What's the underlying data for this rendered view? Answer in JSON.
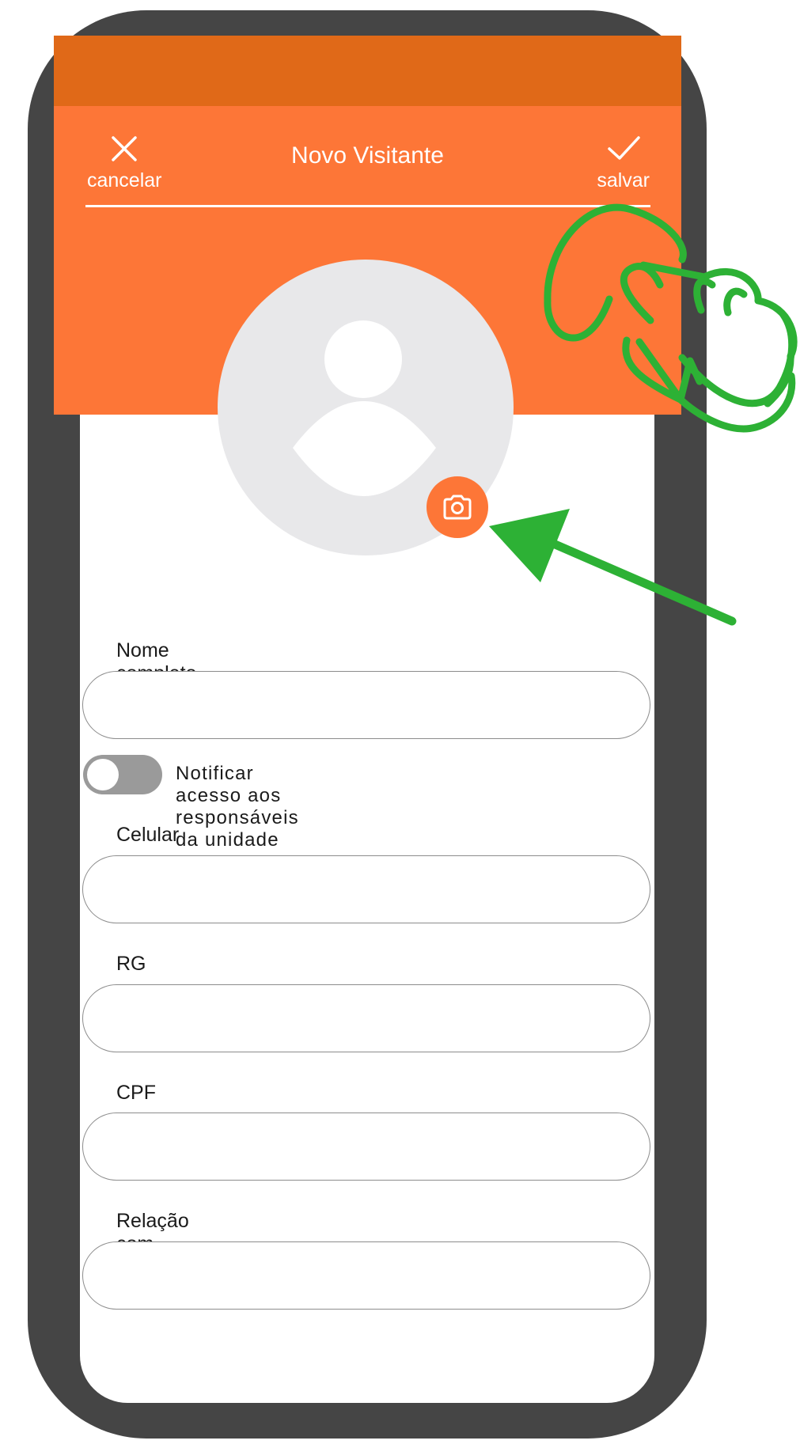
{
  "header": {
    "title": "Novo Visitante",
    "cancel_label": "cancelar",
    "save_label": "salvar"
  },
  "colors": {
    "accent": "#fd7637",
    "status_bar": "#e06918",
    "phone_frame": "#454545",
    "avatar_bg": "#e8e8ea",
    "annotation": "#2db135"
  },
  "form": {
    "nome_label": "Nome completo",
    "notify_label": "Notificar acesso aos responsáveis da unidade",
    "notify_on": false,
    "celular_label": "Celular",
    "rg_label": "RG",
    "cpf_label": "CPF",
    "relacao_label": "Relação com Responsável"
  },
  "icons": {
    "cancel": "close-icon",
    "save": "check-icon",
    "avatar": "user-avatar-icon",
    "camera": "camera-icon",
    "annotation_hand": "tap-hand-icon",
    "annotation_arrow": "arrow-icon"
  }
}
